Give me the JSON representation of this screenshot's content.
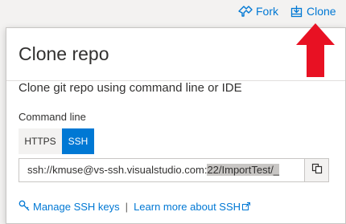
{
  "topbar": {
    "fork_label": "Fork",
    "clone_label": "Clone"
  },
  "panel": {
    "title": "Clone repo",
    "subtitle": "Clone git repo using command line or IDE",
    "command_line_label": "Command line",
    "tabs": [
      {
        "label": "HTTPS",
        "selected": false
      },
      {
        "label": "SSH",
        "selected": true
      }
    ],
    "url_plain": "ssh://kmuse@vs-ssh.visualstudio.com:",
    "url_highlighted": "22/ImportTest/_",
    "links": {
      "manage_ssh_keys": "Manage SSH keys",
      "separator": "|",
      "learn_more_ssh": "Learn more about SSH"
    }
  },
  "colors": {
    "accent": "#0078d4",
    "annotation_arrow": "#e81123"
  },
  "icons": {
    "fork": "fork-icon",
    "clone": "clone-icon",
    "copy": "copy-icon",
    "key": "key-icon",
    "external": "external-link-icon",
    "arrow": "red-arrow-annotation"
  }
}
